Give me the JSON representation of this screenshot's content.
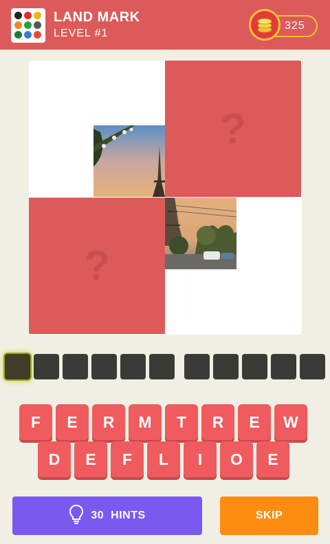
{
  "header": {
    "title": "LAND MARK",
    "level": "LEVEL #1",
    "coins": "325",
    "coin_icon": "coin-stack-icon",
    "app_icon": "logo-grid-icon"
  },
  "board": {
    "hidden_tile_mark": "?",
    "image_subject": "eiffel-tower"
  },
  "answer": {
    "slot_groups": [
      6,
      5
    ],
    "active_slot": 1
  },
  "keyboard": {
    "row1": [
      "F",
      "E",
      "R",
      "M",
      "T",
      "R",
      "E",
      "W"
    ],
    "row2": [
      "D",
      "E",
      "F",
      "L",
      "I",
      "O",
      "E"
    ]
  },
  "actions": {
    "hints_count": "30",
    "hints_label": "HINTS",
    "hints_icon": "lightbulb-icon",
    "skip_label": "SKIP"
  },
  "colors": {
    "header": "#dd5a5b",
    "tile": "#dd5a5b",
    "key": "#ef5b5e",
    "hints": "#7a59f1",
    "skip": "#fd8d11",
    "coin": "#f4c236"
  }
}
